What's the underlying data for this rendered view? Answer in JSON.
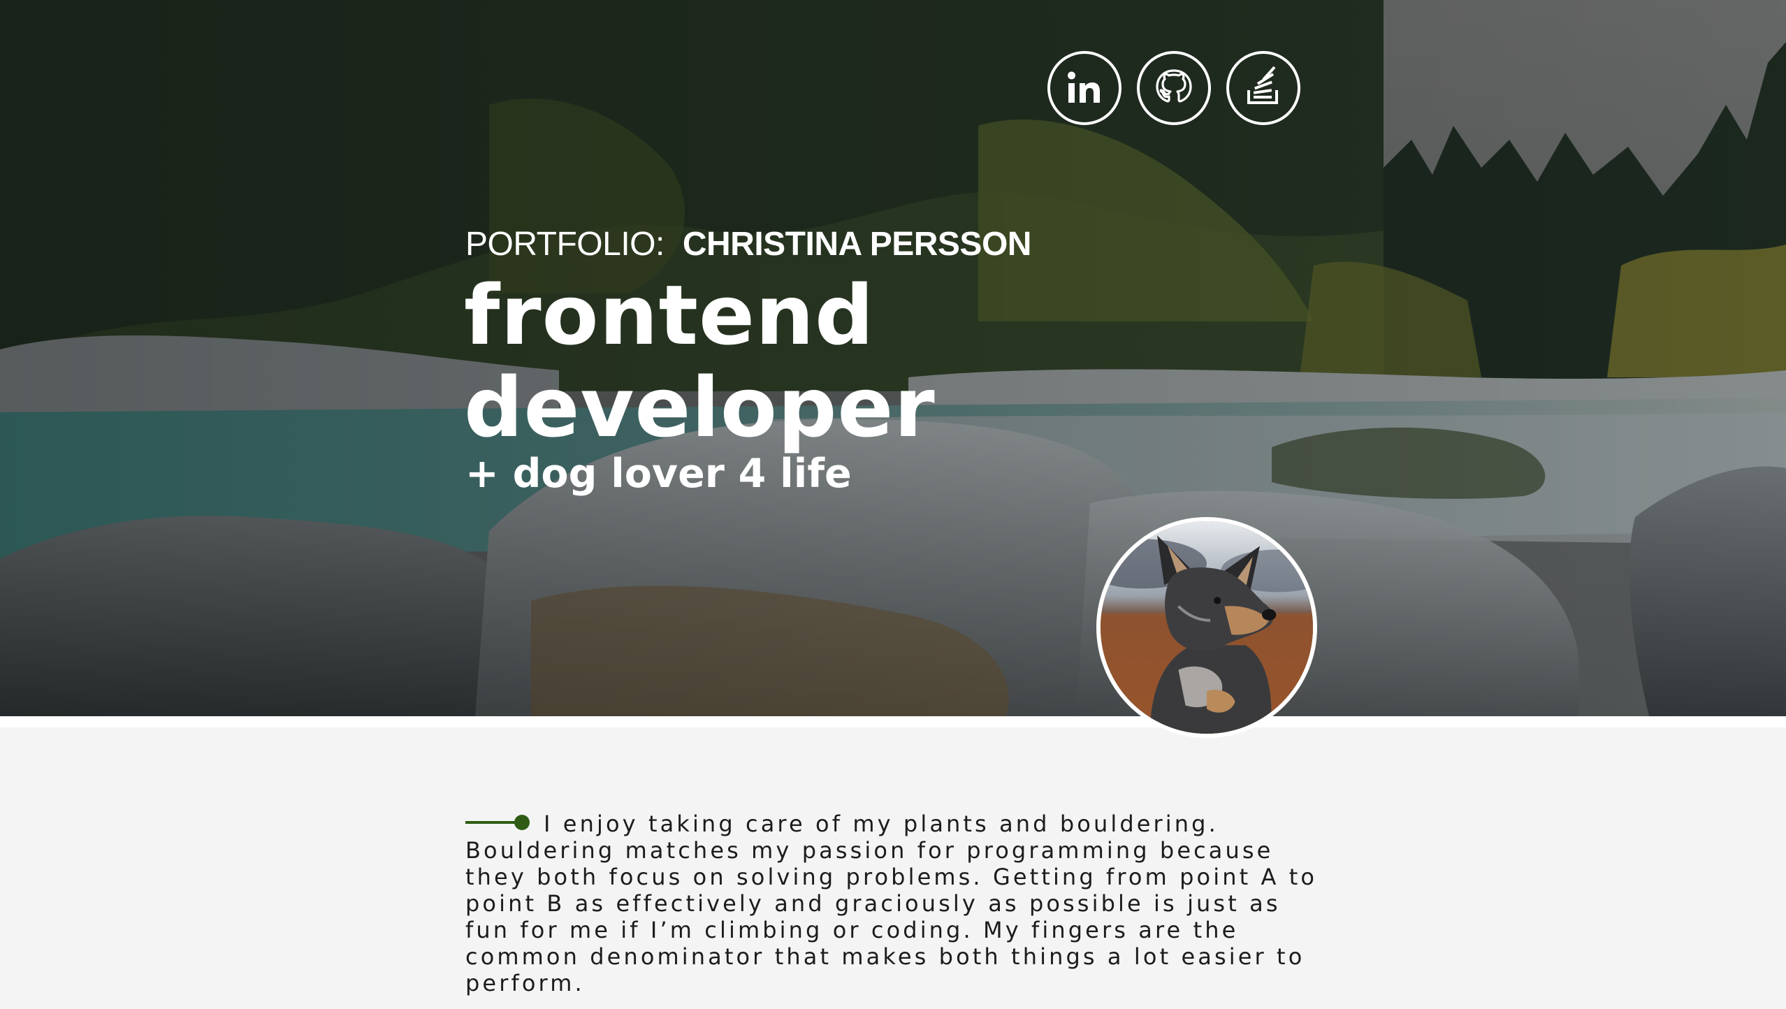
{
  "hero": {
    "eyebrow_label": "PORTFOLIO:",
    "name": "CHRISTINA PERSSON",
    "title_line1": "frontend",
    "title_line2": "developer",
    "subtitle": "+ dog lover 4 life"
  },
  "social_links": [
    {
      "name": "linkedin",
      "icon": "linkedin-icon",
      "label": "in"
    },
    {
      "name": "github",
      "icon": "github-icon"
    },
    {
      "name": "stackoverflow",
      "icon": "stackoverflow-icon"
    }
  ],
  "avatar": {
    "icon": "dog-photo"
  },
  "about": {
    "text": "I enjoy taking care of my plants and bouldering. Bouldering matches my passion for programming because they both focus on solving problems. Getting from point A to point B as effectively and graciously as possible is just as fun for me if I’m climbing or coding. My fingers are the common denominator that makes both things a lot easier to perform."
  },
  "colors": {
    "accent": "#2e5c14",
    "text_light": "#ffffff",
    "text_dark": "#1c1c1c",
    "background": "#f4f4f4"
  }
}
